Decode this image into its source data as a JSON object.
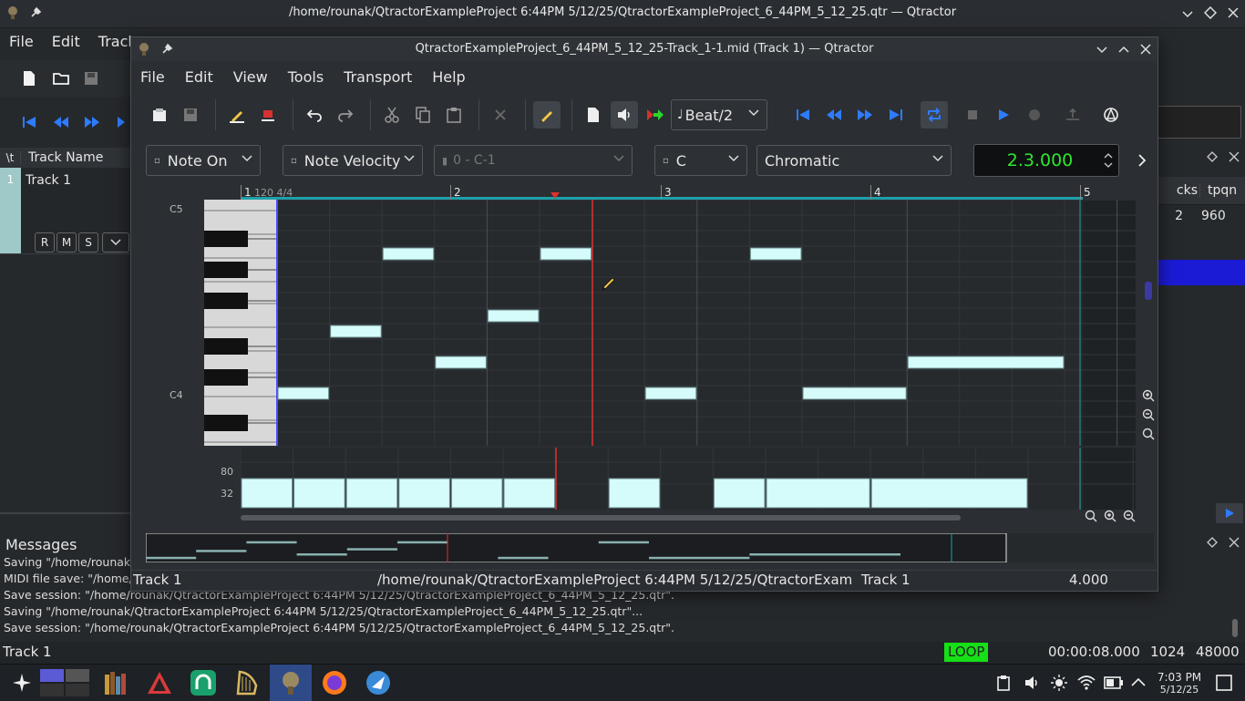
{
  "main_window": {
    "title": "/home/rounak/QtractorExampleProject 6:44PM 5/12/25/QtractorExampleProject_6_44PM_5_12_25.qtr — Qtractor",
    "menu": [
      "File",
      "Edit",
      "Track"
    ],
    "track_list": {
      "col_number": "\\t",
      "col_name": "Track Name",
      "track_number": "1",
      "track_name": "Track 1",
      "buttons": [
        "R",
        "M",
        "S"
      ]
    },
    "right_panel": {
      "col_tracks": "cks",
      "col_tpqn": "tpqn",
      "tracks_value": "2",
      "tpqn_value": "960"
    },
    "messages": {
      "title": "Messages",
      "lines": [
        "Saving \"/home/rounak",
        "MIDI file save: \"/home/",
        "Save session: \"/home/rounak/QtractorExampleProject 6:44PM 5/12/25/QtractorExampleProject_6_44PM_5_12_25.qtr\".",
        "Saving \"/home/rounak/QtractorExampleProject 6:44PM 5/12/25/QtractorExampleProject_6_44PM_5_12_25.qtr\"...",
        "Save session: \"/home/rounak/QtractorExampleProject 6:44PM 5/12/25/QtractorExampleProject_6_44PM_5_12_25.qtr\"."
      ]
    },
    "status": {
      "track": "Track 1",
      "loop": "LOOP",
      "time": "00:00:08.000",
      "buffer": "1024",
      "sample_rate": "48000"
    }
  },
  "editor": {
    "title": "QtractorExampleProject_6_44PM_5_12_25-Track_1-1.mid (Track 1) — Qtractor",
    "menu": [
      "File",
      "Edit",
      "View",
      "Tools",
      "Transport",
      "Help"
    ],
    "snap": "Beat/2",
    "event_type": "Note On",
    "event_param": "Note Velocity",
    "controller": "0 - C-1",
    "key": "C",
    "scale": "Chromatic",
    "position": "2.3.000",
    "ruler": {
      "bar1": "1",
      "tempo": "120 4/4",
      "bar2": "2",
      "bar3": "3",
      "bar4": "4",
      "bar5": "5"
    },
    "piano_labels": {
      "c5": "C5",
      "c4": "C4"
    },
    "velocity_labels": {
      "v80": "80",
      "v32": "32"
    },
    "status": {
      "track": "Track 1",
      "path": "/home/rounak/QtractorExampleProject 6:44PM 5/12/25/QtractorExam",
      "track2": "Track 1",
      "length": "4.000"
    }
  },
  "taskbar": {
    "clock_time": "7:03 PM",
    "clock_date": "5/12/25"
  },
  "colors": {
    "note_fill": "#d6fbfb",
    "playhead": "#e0302c",
    "loop_bg": "#16e016",
    "lcd_text": "#2ee62e",
    "selection": "#1b1bd6"
  }
}
